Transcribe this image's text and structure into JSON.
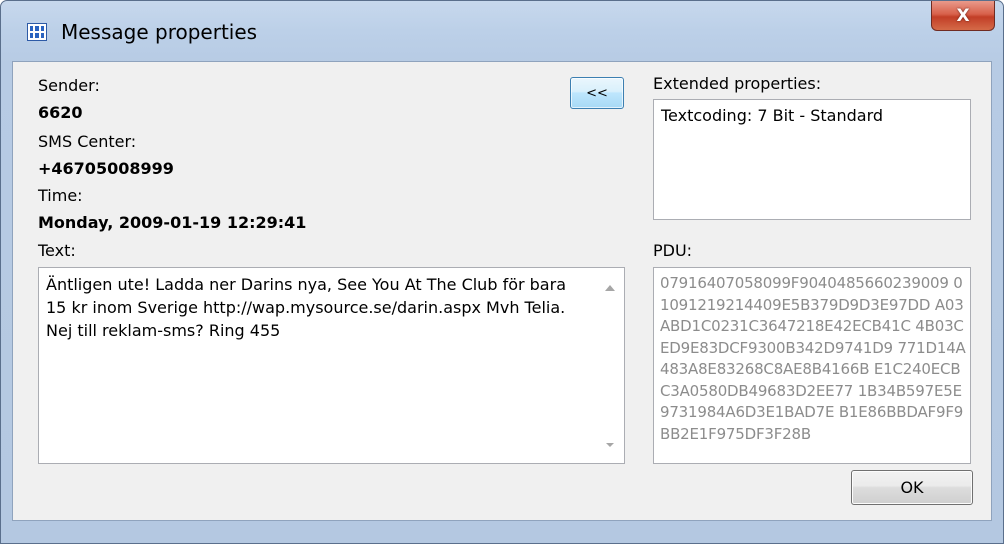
{
  "window": {
    "title": "Message properties",
    "close_label": "X"
  },
  "left": {
    "sender_label": "Sender:",
    "sender_value": "6620",
    "sms_center_label": "SMS Center:",
    "sms_center_value": "+46705008999",
    "time_label": "Time:",
    "time_value": "Monday, 2009-01-19 12:29:41",
    "text_label": "Text:",
    "text_value": "Äntligen ute! Ladda ner Darins nya, See You At The Club för bara 15 kr inom Sverige http://wap.mysource.se/darin.aspx Mvh Telia. Nej till reklam-sms? Ring 455"
  },
  "toggle_button_label": "<<",
  "right": {
    "extended_label": "Extended properties:",
    "extended_value": "Textcoding: 7 Bit - Standard",
    "pdu_label": "PDU:",
    "pdu_value": "07916407058099F9040485660239009 01091219214409E5B379D9D3E97DD A03ABD1C0231C3647218E42ECB41C 4B03CED9E83DCF9300B342D9741D9 771D14A483A8E83268C8AE8B4166B E1C240ECBC3A0580DB49683D2EE77 1B34B597E5E9731984A6D3E1BAD7E B1E86BBDAF9F9BB2E1F975DF3F28B"
  },
  "buttons": {
    "ok_label": "OK"
  }
}
